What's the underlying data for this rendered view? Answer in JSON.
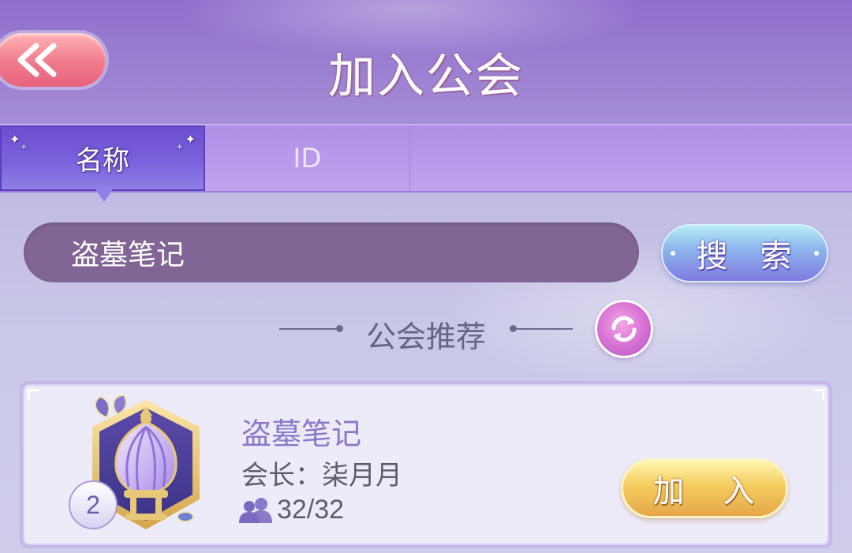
{
  "header": {
    "title": "加入公会",
    "back_icon": "double-chevron-left-icon"
  },
  "tabs": [
    {
      "label": "名称",
      "active": true
    },
    {
      "label": "ID",
      "active": false
    }
  ],
  "search": {
    "value": "盗墓笔记",
    "button_label": "搜 索"
  },
  "recommend": {
    "title": "公会推荐",
    "refresh_icon": "refresh-icon"
  },
  "guilds": [
    {
      "name": "盗墓笔记",
      "leader_label": "会长：柒月月",
      "members": "32/32",
      "level": "2",
      "join_label": "加 入",
      "emblem_icon": "crown-emblem-icon"
    }
  ],
  "colors": {
    "tab_active": "#6d4fd0",
    "search_button": "#8fb8ee",
    "join_button": "#f5cd5e",
    "back_button": "#f07a8c",
    "refresh_button": "#d56fd2"
  }
}
